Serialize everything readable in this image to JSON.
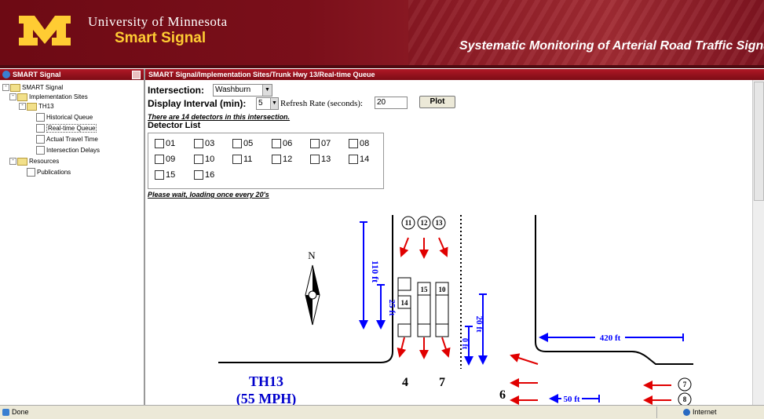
{
  "header": {
    "university": "University of Minnesota",
    "product": "Smart Signal",
    "tagline": "Systematic Monitoring of Arterial Road Traffic Signals"
  },
  "sidebar": {
    "title": "SMART Signal",
    "items": [
      {
        "label": "SMART Signal"
      },
      {
        "label": "Implementation Sites"
      },
      {
        "label": "TH13"
      },
      {
        "label": "Historical Queue"
      },
      {
        "label": "Real-time Queue"
      },
      {
        "label": "Actual Travel Time"
      },
      {
        "label": "Intersection Delays"
      },
      {
        "label": "Resources"
      },
      {
        "label": "Publications"
      }
    ]
  },
  "content": {
    "breadcrumb": "SMART Signal/Implementation Sites/Trunk Hwy 13/Real-time Queue",
    "intersection_label": "Intersection:",
    "intersection_value": "Washburn",
    "display_interval_label": "Display Interval (min):",
    "display_interval_value": "5",
    "refresh_label": "Refresh Rate (seconds):",
    "refresh_value": "20",
    "plot_button": "Plot",
    "detector_note": "There are 14 detectors in this intersection.",
    "detector_list_title": "Detector List",
    "detectors": [
      "01",
      "03",
      "05",
      "06",
      "07",
      "08",
      "09",
      "10",
      "11",
      "12",
      "13",
      "14",
      "15",
      "16"
    ],
    "loading_note": "Please wait, loading once every 20's"
  },
  "diagram": {
    "north": "N",
    "dist_110": "110 ft",
    "dist_25": "25 ft",
    "dist_20": "20 ft",
    "dist_0": "0 ft",
    "dist_420": "420 ft",
    "dist_50": "50 ft",
    "det_11": "11",
    "det_12": "12",
    "det_13": "13",
    "det_15": "15",
    "det_10": "10",
    "det_14": "14",
    "det_7": "7",
    "det_8": "8",
    "approach_4": "4",
    "approach_7": "7",
    "approach_6": "6",
    "road_name": "TH13",
    "speed": "(55 MPH)"
  },
  "status": {
    "left": "Done",
    "zone": "Internet"
  },
  "colors": {
    "maroon": "#7a0019",
    "gold": "#ffcc33",
    "blue": "#0000ff",
    "red": "#e00000"
  }
}
